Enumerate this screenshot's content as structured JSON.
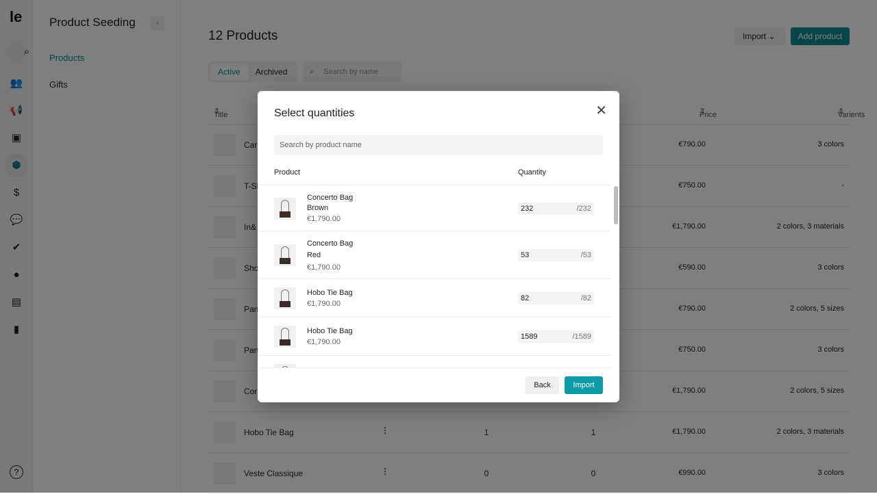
{
  "rail": {
    "logo": "le",
    "icons": [
      "search-icon",
      "users-icon",
      "megaphone-icon",
      "bag-icon",
      "box-icon",
      "dollar-icon",
      "chat-icon",
      "user-check-icon",
      "compass-icon",
      "newspaper-icon",
      "chart-icon"
    ],
    "help": "?"
  },
  "side": {
    "title": "Product Seeding",
    "items": [
      {
        "label": "Products"
      },
      {
        "label": "Gifts"
      }
    ]
  },
  "main": {
    "title": "12 Products",
    "import_label": "Import",
    "add_label": "Add product",
    "tabs": [
      "Active",
      "Archived"
    ],
    "search_placeholder": "Search by name",
    "columns": {
      "title": "Title",
      "price": "Price",
      "variants": "Varients"
    },
    "rows": [
      {
        "name": "Car",
        "price": "€790.00",
        "variants": "3 colors"
      },
      {
        "name": "T-Sh",
        "price": "€750.00",
        "variants": "-"
      },
      {
        "name": "In&",
        "price": "€1,790.00",
        "variants": "2 colors, 3 materials"
      },
      {
        "name": "Sho",
        "price": "€590.00",
        "variants": "3 colors"
      },
      {
        "name": "Pan",
        "price": "€790.00",
        "variants": "2 colors, 5 sizes"
      },
      {
        "name": "Pan",
        "price": "€750.00",
        "variants": "3 colors"
      },
      {
        "name": "Cor",
        "price": "€1,790.00",
        "variants": "2 colors, 5 sizes"
      },
      {
        "name": "Hobo Tie Bag",
        "c1": "1",
        "c2": "1",
        "price": "€1,790.00",
        "variants": "2 colors, 3 materials"
      },
      {
        "name": "Veste Classique",
        "c1": "0",
        "c2": "0",
        "price": "€990.00",
        "variants": "3 colors"
      }
    ]
  },
  "modal": {
    "title": "Select quantities",
    "search_placeholder": "Search by product name",
    "col_product": "Product",
    "col_quantity": "Quantity",
    "items": [
      {
        "name": "Concerto Bag",
        "variant": "Brown",
        "price": "€1,790.00",
        "qty": "232",
        "max": "/232"
      },
      {
        "name": "Concerto Bag",
        "variant": "Red",
        "price": "€1,790.00",
        "qty": "53",
        "max": "/53"
      },
      {
        "name": "Hobo Tie Bag",
        "price": "€1,790.00",
        "qty": "82",
        "max": "/82"
      },
      {
        "name": "Hobo Tie Bag",
        "price": "€1,790.00",
        "qty": "1589",
        "max": "/1589"
      }
    ],
    "back_label": "Back",
    "import_label": "Import"
  },
  "colors": {
    "accent": "#0e8a96",
    "button": "#0e9aa6"
  }
}
